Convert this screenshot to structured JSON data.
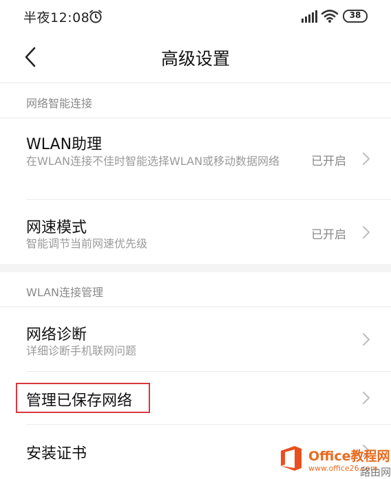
{
  "status_bar": {
    "time": "半夜12:08",
    "battery": "38",
    "icons": [
      "alarm-icon",
      "signal-icon",
      "wifi-icon",
      "battery-icon"
    ]
  },
  "header": {
    "title": "高级设置",
    "back_icon": "chevron-left-icon"
  },
  "sections": [
    {
      "header": "网络智能连接",
      "rows": [
        {
          "title": "WLAN助理",
          "description": "在WLAN连接不佳时智能选择WLAN或移动数据网络",
          "value": "已开启"
        },
        {
          "title": "网速模式",
          "description": "智能调节当前网速优先级",
          "value": "已开启"
        }
      ]
    },
    {
      "header": "WLAN连接管理",
      "rows": [
        {
          "title": "网络诊断",
          "description": "详细诊断手机联网问题",
          "value": ""
        },
        {
          "title": "管理已保存网络",
          "description": "",
          "value": ""
        },
        {
          "title": "安装证书",
          "description": "",
          "value": ""
        }
      ]
    }
  ],
  "highlight_color": "#d9363e",
  "watermark": {
    "brand": "Office教程网",
    "url": "www.office26.com",
    "side": "路由网"
  }
}
